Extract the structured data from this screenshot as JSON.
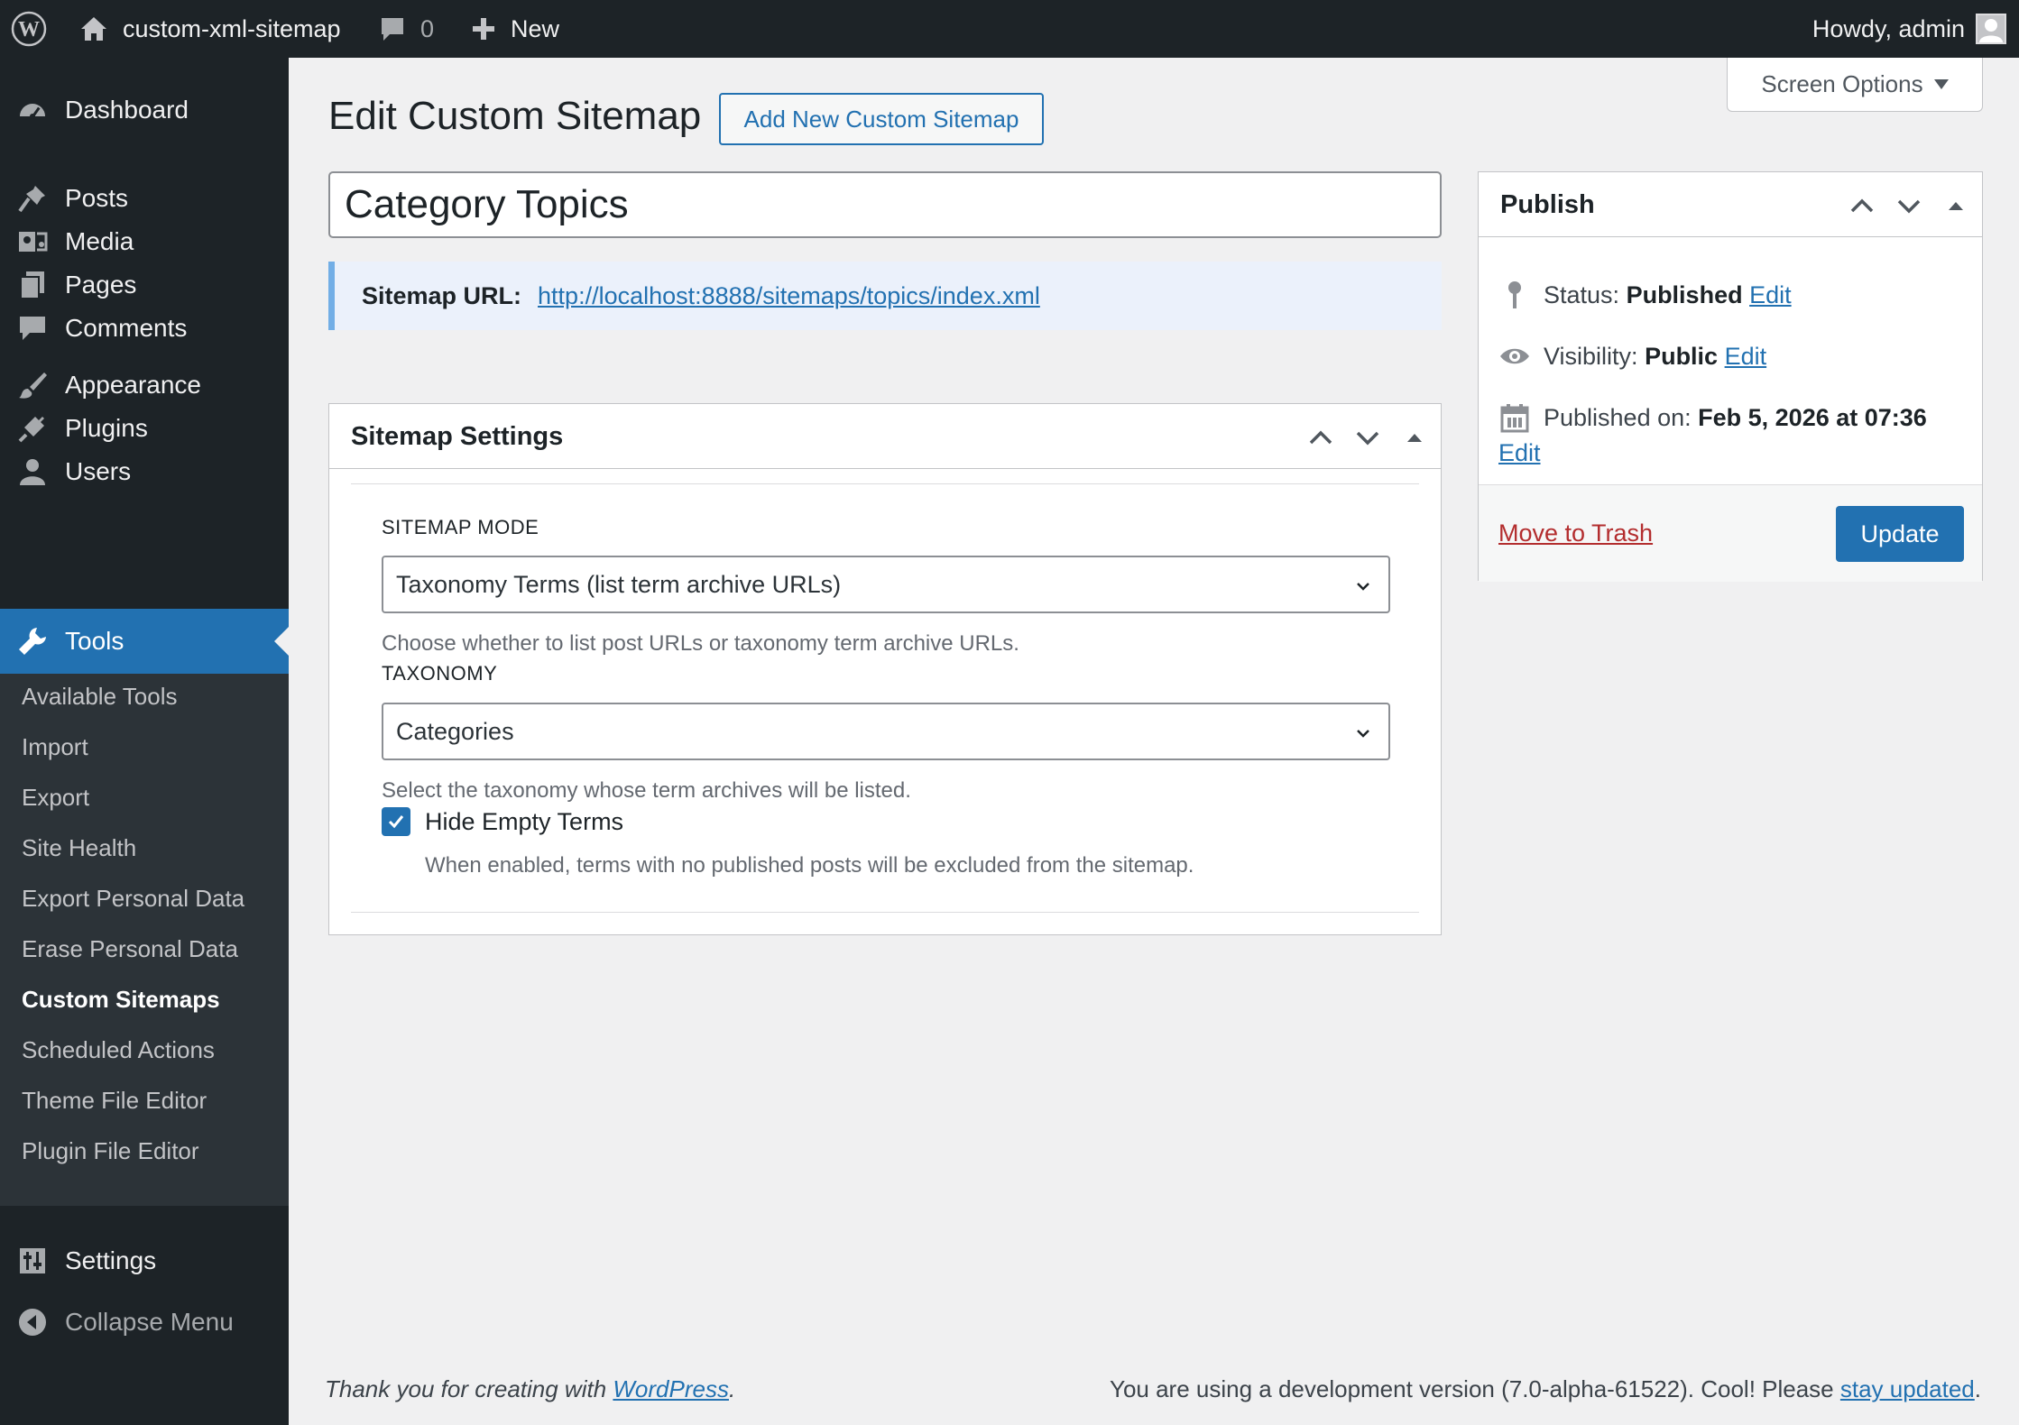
{
  "adminbar": {
    "site_name": "custom-xml-sitemap",
    "comments_count": "0",
    "new_label": "New",
    "howdy": "Howdy, admin"
  },
  "sidebar": {
    "items": [
      {
        "label": "Dashboard",
        "icon": "dashboard-icon"
      },
      {
        "label": "Posts",
        "icon": "pin-icon"
      },
      {
        "label": "Media",
        "icon": "media-icon"
      },
      {
        "label": "Pages",
        "icon": "pages-icon"
      },
      {
        "label": "Comments",
        "icon": "comment-icon"
      },
      {
        "label": "Appearance",
        "icon": "brush-icon"
      },
      {
        "label": "Plugins",
        "icon": "plugin-icon"
      },
      {
        "label": "Users",
        "icon": "users-icon"
      },
      {
        "label": "Tools",
        "icon": "wrench-icon"
      },
      {
        "label": "Settings",
        "icon": "settings-icon"
      },
      {
        "label": "Collapse Menu",
        "icon": "collapse-icon"
      }
    ],
    "tools_submenu": [
      "Available Tools",
      "Import",
      "Export",
      "Site Health",
      "Export Personal Data",
      "Erase Personal Data",
      "Custom Sitemaps",
      "Scheduled Actions",
      "Theme File Editor",
      "Plugin File Editor"
    ],
    "current_submenu": "Custom Sitemaps"
  },
  "screen_options": "Screen Options",
  "page": {
    "title": "Edit Custom Sitemap",
    "add_new": "Add New Custom Sitemap",
    "post_title": "Category Topics",
    "sitemap_url_label": "Sitemap URL:",
    "sitemap_url": "http://localhost:8888/sitemaps/topics/index.xml"
  },
  "settings_box": {
    "title": "Sitemap Settings",
    "mode_label": "SITEMAP MODE",
    "mode_value": "Taxonomy Terms (list term archive URLs)",
    "mode_desc": "Choose whether to list post URLs or taxonomy term archive URLs.",
    "taxonomy_label": "TAXONOMY",
    "taxonomy_value": "Categories",
    "taxonomy_desc": "Select the taxonomy whose term archives will be listed.",
    "hide_empty_label": "Hide Empty Terms",
    "hide_empty_checked": true,
    "hide_empty_desc": "When enabled, terms with no published posts will be excluded from the sitemap."
  },
  "publish_box": {
    "title": "Publish",
    "status_label": "Status:",
    "status_value": "Published",
    "visibility_label": "Visibility:",
    "visibility_value": "Public",
    "published_label": "Published on:",
    "published_value": "Feb 5, 2026 at 07:36",
    "edit": "Edit",
    "trash": "Move to Trash",
    "update": "Update"
  },
  "footer": {
    "thanks_prefix": "Thank you for creating with ",
    "thanks_link": "WordPress",
    "thanks_suffix": ".",
    "version_prefix": "You are using a development version (7.0-alpha-61522). Cool! Please ",
    "version_link": "stay updated",
    "version_suffix": "."
  },
  "colors": {
    "admin_dark": "#1d2327",
    "submenu_bg": "#2c3338",
    "accent": "#2271b1",
    "notice_border": "#72aee6",
    "trash_red": "#b32d2e"
  }
}
